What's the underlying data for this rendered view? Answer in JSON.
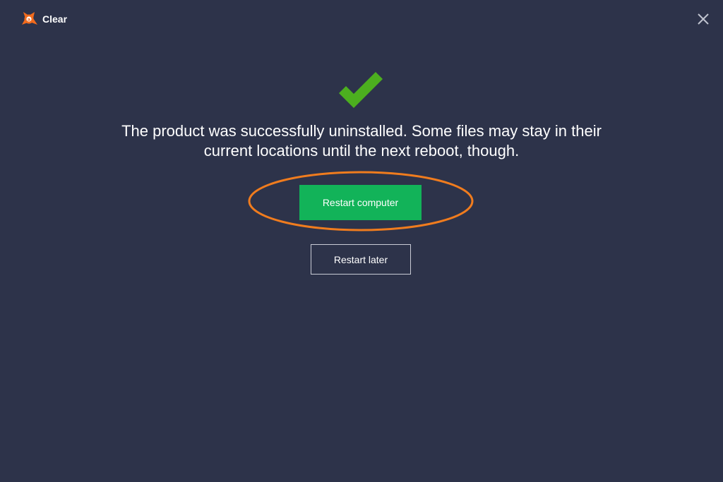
{
  "window": {
    "title": "Clear",
    "logo_icon": "avast-logo-icon",
    "close_icon": "close-icon"
  },
  "main": {
    "status_icon": "checkmark-icon",
    "message_lines": [
      "The product was successfully uninstalled. Some files may stay in their",
      "current locations until the next reboot, though."
    ],
    "restart_now_label": "Restart computer",
    "restart_later_label": "Restart later"
  },
  "colors": {
    "background": "#2d334a",
    "primary_button": "#12b359",
    "checkmark": "#4caf1f",
    "logo": "#f26b1d",
    "highlight_ring": "#f07c1e"
  }
}
